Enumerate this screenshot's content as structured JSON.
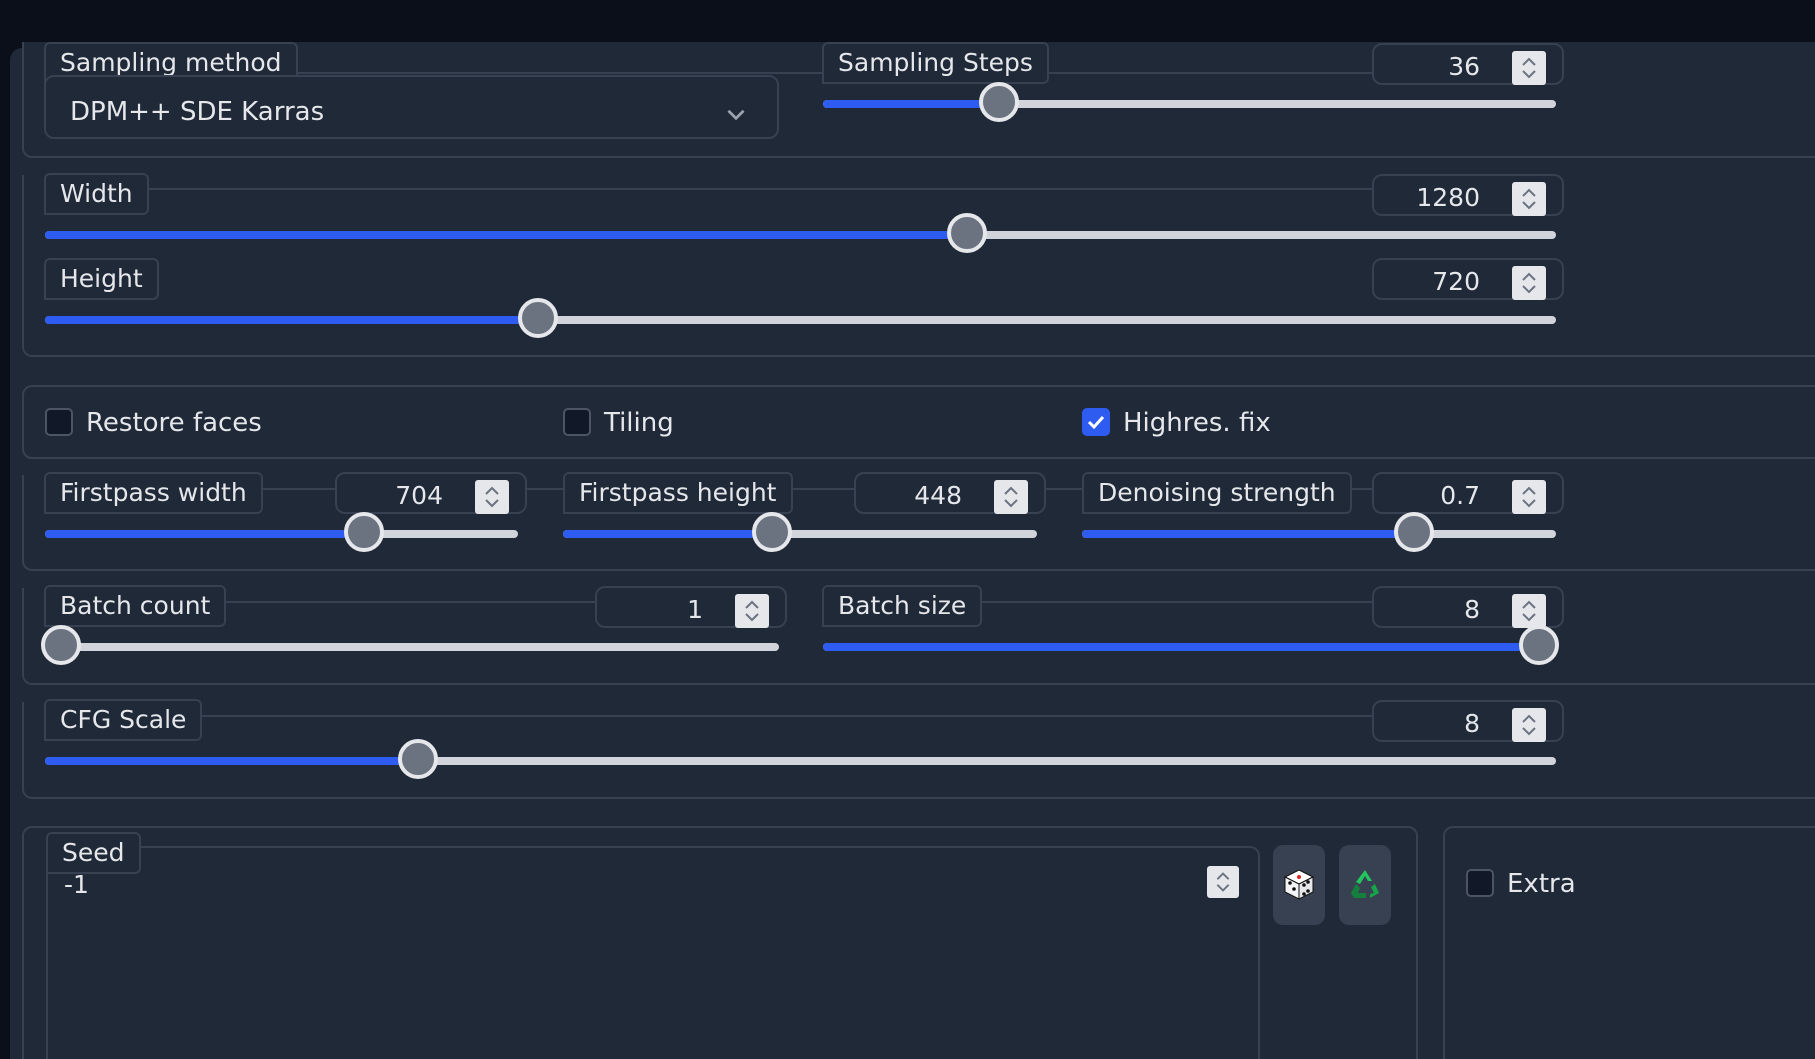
{
  "colors": {
    "accent": "#2f5cf0",
    "panel": "#1f2937",
    "border": "#374151",
    "background": "#0b0f19"
  },
  "sampling_method": {
    "label": "Sampling method",
    "value": "DPM++ SDE Karras",
    "icon": "chevron-down-icon"
  },
  "sampling_steps": {
    "label": "Sampling Steps",
    "value": "36",
    "fraction": 0.24
  },
  "width": {
    "label": "Width",
    "value": "1280",
    "fraction": 0.61
  },
  "height": {
    "label": "Height",
    "value": "720",
    "fraction": 0.326
  },
  "options": {
    "restore_faces": {
      "label": "Restore faces",
      "checked": false
    },
    "tiling": {
      "label": "Tiling",
      "checked": false
    },
    "highres_fix": {
      "label": "Highres. fix",
      "checked": true
    }
  },
  "firstpass_width": {
    "label": "Firstpass width",
    "value": "704",
    "fraction": 0.675
  },
  "firstpass_height": {
    "label": "Firstpass height",
    "value": "448",
    "fraction": 0.44
  },
  "denoising_strength": {
    "label": "Denoising strength",
    "value": "0.7",
    "fraction": 0.7
  },
  "batch_count": {
    "label": "Batch count",
    "value": "1",
    "fraction": 0.0
  },
  "batch_size": {
    "label": "Batch size",
    "value": "8",
    "fraction": 1.0
  },
  "cfg_scale": {
    "label": "CFG Scale",
    "value": "8",
    "fraction": 0.247
  },
  "seed": {
    "label": "Seed",
    "value": "-1",
    "random_icon": "dice-icon",
    "reuse_icon": "recycle-icon"
  },
  "extra": {
    "label": "Extra",
    "checked": false
  }
}
